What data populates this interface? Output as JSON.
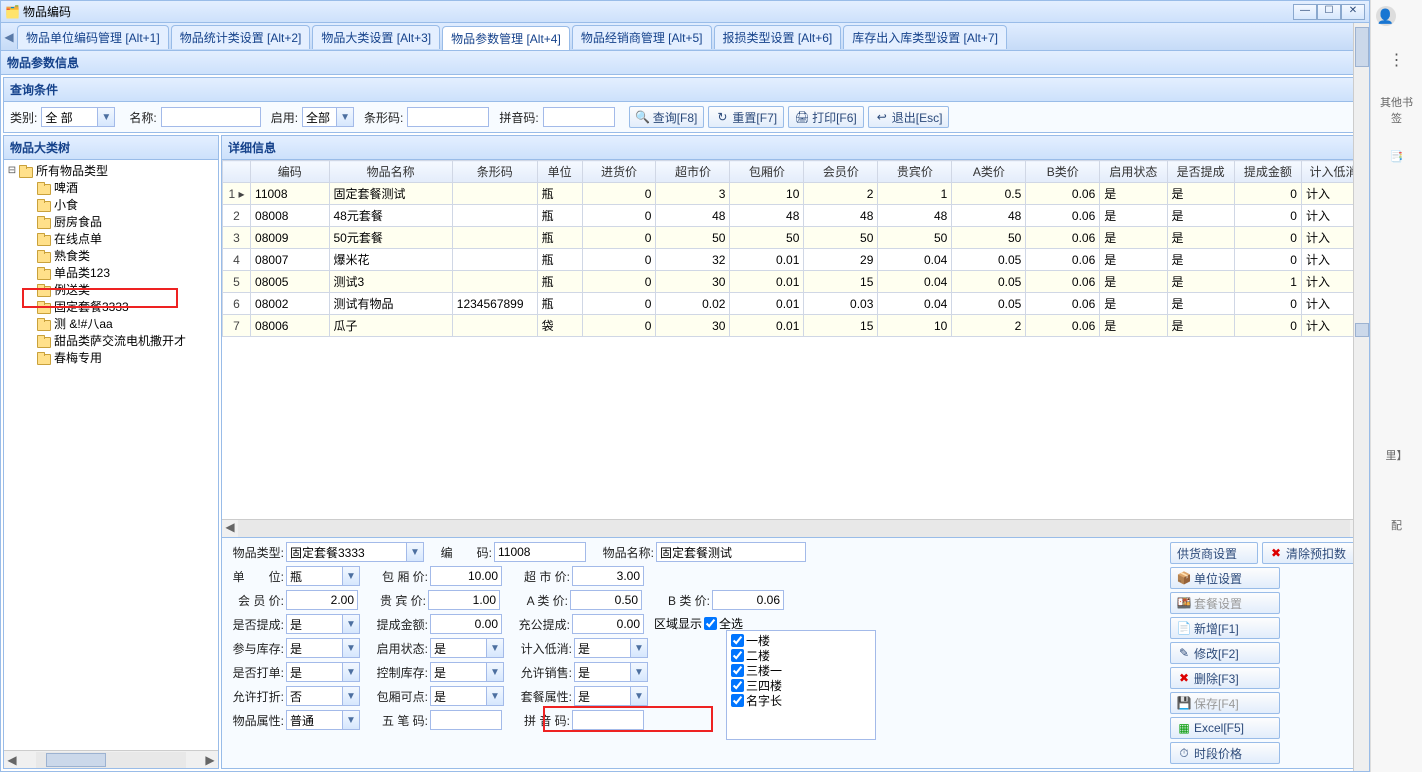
{
  "window": {
    "title": "物品编码"
  },
  "tabs": [
    {
      "label": "物品单位编码管理 [Alt+1]"
    },
    {
      "label": "物品统计类设置 [Alt+2]"
    },
    {
      "label": "物品大类设置 [Alt+3]"
    },
    {
      "label": "物品参数管理 [Alt+4]"
    },
    {
      "label": "物品经销商管理 [Alt+5]"
    },
    {
      "label": "报损类型设置 [Alt+6]"
    },
    {
      "label": "库存出入库类型设置 [Alt+7]"
    }
  ],
  "section_title": "物品参数信息",
  "query": {
    "title": "查询条件",
    "category_label": "类别:",
    "category_value": "全 部",
    "name_label": "名称:",
    "name_value": "",
    "enabled_label": "启用:",
    "enabled_value": "全部",
    "barcode_label": "条形码:",
    "barcode_value": "",
    "pinyin_label": "拼音码:",
    "pinyin_value": "",
    "btn_search": "查询[F8]",
    "btn_reset": "重置[F7]",
    "btn_print": "打印[F6]",
    "btn_exit": "退出[Esc]"
  },
  "tree": {
    "title": "物品大类树",
    "root": "所有物品类型",
    "children": [
      "啤酒",
      "小食",
      "厨房食品",
      "在线点单",
      "熟食类",
      "单品类123",
      "例送类",
      "固定套餐3333",
      "测 &!#八aa",
      "甜品类萨交流电机撒开才",
      "春梅专用"
    ]
  },
  "detail": {
    "title": "详细信息",
    "columns": [
      "",
      "编码",
      "物品名称",
      "条形码",
      "单位",
      "进货价",
      "超市价",
      "包厢价",
      "会员价",
      "贵宾价",
      "A类价",
      "B类价",
      "启用状态",
      "是否提成",
      "提成金额",
      "计入低消"
    ],
    "rows": [
      {
        "n": "1",
        "code": "11008",
        "name": "固定套餐测试",
        "barcode": "",
        "unit": "瓶",
        "pin": "0",
        "sup": "3",
        "box": "10",
        "mem": "2",
        "vip": "1",
        "a": "0.5",
        "b": "0.06",
        "en": "是",
        "tc": "是",
        "tcj": "0",
        "jr": "计入"
      },
      {
        "n": "2",
        "code": "08008",
        "name": "48元套餐",
        "barcode": "",
        "unit": "瓶",
        "pin": "0",
        "sup": "48",
        "box": "48",
        "mem": "48",
        "vip": "48",
        "a": "48",
        "b": "0.06",
        "en": "是",
        "tc": "是",
        "tcj": "0",
        "jr": "计入"
      },
      {
        "n": "3",
        "code": "08009",
        "name": "50元套餐",
        "barcode": "",
        "unit": "瓶",
        "pin": "0",
        "sup": "50",
        "box": "50",
        "mem": "50",
        "vip": "50",
        "a": "50",
        "b": "0.06",
        "en": "是",
        "tc": "是",
        "tcj": "0",
        "jr": "计入"
      },
      {
        "n": "4",
        "code": "08007",
        "name": "爆米花",
        "barcode": "",
        "unit": "瓶",
        "pin": "0",
        "sup": "32",
        "box": "0.01",
        "mem": "29",
        "vip": "0.04",
        "a": "0.05",
        "b": "0.06",
        "en": "是",
        "tc": "是",
        "tcj": "0",
        "jr": "计入"
      },
      {
        "n": "5",
        "code": "08005",
        "name": "测试3",
        "barcode": "",
        "unit": "瓶",
        "pin": "0",
        "sup": "30",
        "box": "0.01",
        "mem": "15",
        "vip": "0.04",
        "a": "0.05",
        "b": "0.06",
        "en": "是",
        "tc": "是",
        "tcj": "1",
        "jr": "计入"
      },
      {
        "n": "6",
        "code": "08002",
        "name": "测试有物品",
        "barcode": "1234567899",
        "unit": "瓶",
        "pin": "0",
        "sup": "0.02",
        "box": "0.01",
        "mem": "0.03",
        "vip": "0.04",
        "a": "0.05",
        "b": "0.06",
        "en": "是",
        "tc": "是",
        "tcj": "0",
        "jr": "计入"
      },
      {
        "n": "7",
        "code": "08006",
        "name": "瓜子",
        "barcode": "",
        "unit": "袋",
        "pin": "0",
        "sup": "30",
        "box": "0.01",
        "mem": "15",
        "vip": "10",
        "a": "2",
        "b": "0.06",
        "en": "是",
        "tc": "是",
        "tcj": "0",
        "jr": "计入"
      }
    ]
  },
  "form": {
    "type_label": "物品类型:",
    "type_value": "固定套餐3333",
    "code_label": "编　　码:",
    "code_value": "11008",
    "name_label": "物品名称:",
    "name_value": "固定套餐测试",
    "unit_label": "单　　位:",
    "unit_value": "瓶",
    "box_price_label": "包 厢 价:",
    "box_price_value": "10.00",
    "sup_price_label": "超 市 价:",
    "sup_price_value": "3.00",
    "mem_price_label": "会 员 价:",
    "mem_price_value": "2.00",
    "vip_price_label": "贵 宾 价:",
    "vip_price_value": "1.00",
    "a_price_label": "A 类 价:",
    "a_price_value": "0.50",
    "b_price_label": "B 类 价:",
    "b_price_value": "0.06",
    "tc_label": "是否提成:",
    "tc_value": "是",
    "tcj_label": "提成金额:",
    "tcj_value": "0.00",
    "cg_label": "充公提成:",
    "cg_value": "0.00",
    "cyk_label": "参与库存:",
    "cyk_value": "是",
    "en_label": "启用状态:",
    "en_value": "是",
    "jrd_label": "计入低消:",
    "jrd_value": "是",
    "sfd_label": "是否打单:",
    "sfd_value": "是",
    "kzk_label": "控制库存:",
    "kzk_value": "是",
    "yxx_label": "允许销售:",
    "yxx_value": "是",
    "yxz_label": "允许打折:",
    "yxz_value": "否",
    "bxk_label": "包厢可点:",
    "bxk_value": "是",
    "tcsx_label": "套餐属性:",
    "tcsx_value": "是",
    "wpsx_label": "物品属性:",
    "wpsx_value": "普通",
    "wbm_label": "五 笔 码:",
    "wbm_value": "",
    "pym_label": "拼 音 码:",
    "pym_value": "",
    "region_title": "区域显示",
    "region_all": "全选",
    "regions": [
      "一楼",
      "二楼",
      "三楼一",
      "三四楼",
      "名字长"
    ]
  },
  "buttons": {
    "supplier": "供货商设置",
    "clear_pre": "清除预扣数",
    "unit": "单位设置",
    "set_meal": "套餐设置",
    "new": "新增[F1]",
    "edit": "修改[F2]",
    "delete": "删除[F3]",
    "save": "保存[F4]",
    "excel": "Excel[F5]",
    "period": "时段价格"
  },
  "sidebar": {
    "other_bookmarks": "其他书签",
    "manage_suffix": "里】",
    "config_suffix": "配"
  }
}
